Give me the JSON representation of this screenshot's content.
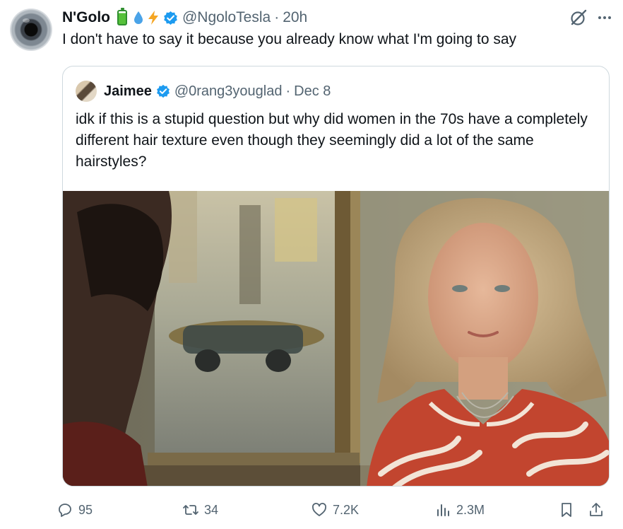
{
  "tweet": {
    "author_name": "N'Golo",
    "handle": "@NgoloTesla",
    "separator": "·",
    "time": "20h",
    "name_emojis": [
      "battery-icon",
      "droplet-icon",
      "lightning-icon"
    ],
    "text": "I don't have to say it because you already know what I'm going to say"
  },
  "quote": {
    "author_name": "Jaimee",
    "handle": "@0rang3youglad",
    "separator": "·",
    "date": "Dec 8",
    "text": "idk if this is a stupid question but why did women in the 70s have a completely different hair texture even though they seemingly did a lot of the same hairstyles?"
  },
  "actions": {
    "replies": "95",
    "reposts": "34",
    "likes": "7.2K",
    "views": "2.3M"
  },
  "colors": {
    "verified": "#1d9bf0",
    "secondary_text": "#536471",
    "border": "#cfd9de"
  }
}
